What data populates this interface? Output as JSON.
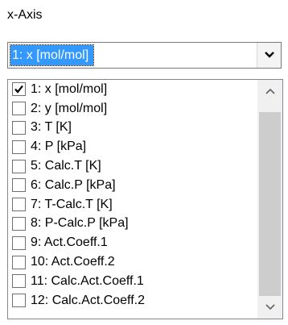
{
  "xaxis_group": {
    "label": "x-Axis"
  },
  "combo": {
    "selected": "1: x [mol/mol]",
    "dropdown_icon": "chevron-down-icon"
  },
  "list": {
    "items": [
      {
        "label": "1: x [mol/mol]",
        "checked": true
      },
      {
        "label": "2: y [mol/mol]",
        "checked": false
      },
      {
        "label": "3: T [K]",
        "checked": false
      },
      {
        "label": "4: P [kPa]",
        "checked": false
      },
      {
        "label": "5: Calc.T [K]",
        "checked": false
      },
      {
        "label": "6: Calc.P [kPa]",
        "checked": false
      },
      {
        "label": "7: T-Calc.T [K]",
        "checked": false
      },
      {
        "label": "8: P-Calc.P [kPa]",
        "checked": false
      },
      {
        "label": "9: Act.Coeff.1",
        "checked": false
      },
      {
        "label": "10: Act.Coeff.2",
        "checked": false
      },
      {
        "label": "11: Calc.Act.Coeff.1",
        "checked": false
      },
      {
        "label": "12: Calc.Act.Coeff.2",
        "checked": false
      }
    ]
  },
  "scrollbar": {
    "up_icon": "chevron-up-icon",
    "down_icon": "chevron-down-icon"
  }
}
